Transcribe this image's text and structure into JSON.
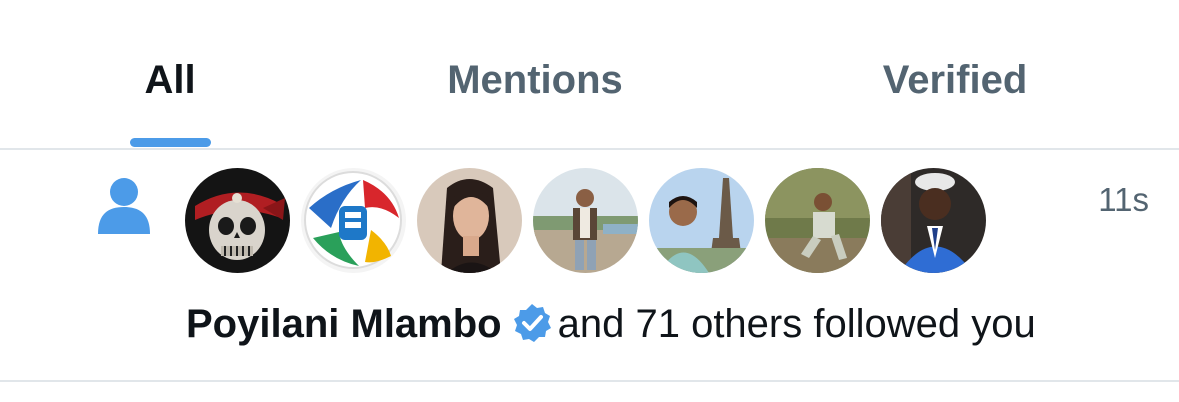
{
  "tabs": [
    {
      "label": "All",
      "active": true
    },
    {
      "label": "Mentions",
      "active": false
    },
    {
      "label": "Verified",
      "active": false
    }
  ],
  "colors": {
    "accent": "#4c9be8",
    "verified_badge": "#4c9be8",
    "muted_text": "#536471",
    "primary_text": "#0f1419",
    "divider": "#e1e6ea"
  },
  "notification": {
    "type_icon": "person-icon",
    "timestamp": "11s",
    "avatars": [
      {
        "name": "avatar-skull-pirate"
      },
      {
        "name": "avatar-soccer-ball"
      },
      {
        "name": "avatar-woman-portrait"
      },
      {
        "name": "avatar-man-by-river"
      },
      {
        "name": "avatar-man-eiffel-tower"
      },
      {
        "name": "avatar-man-sitting-outdoors"
      },
      {
        "name": "avatar-man-blue-suit"
      }
    ],
    "user_name": "Poyilani Mlambo",
    "verified_icon": "verified-badge-icon",
    "message_rest": "and 71 others followed you"
  }
}
